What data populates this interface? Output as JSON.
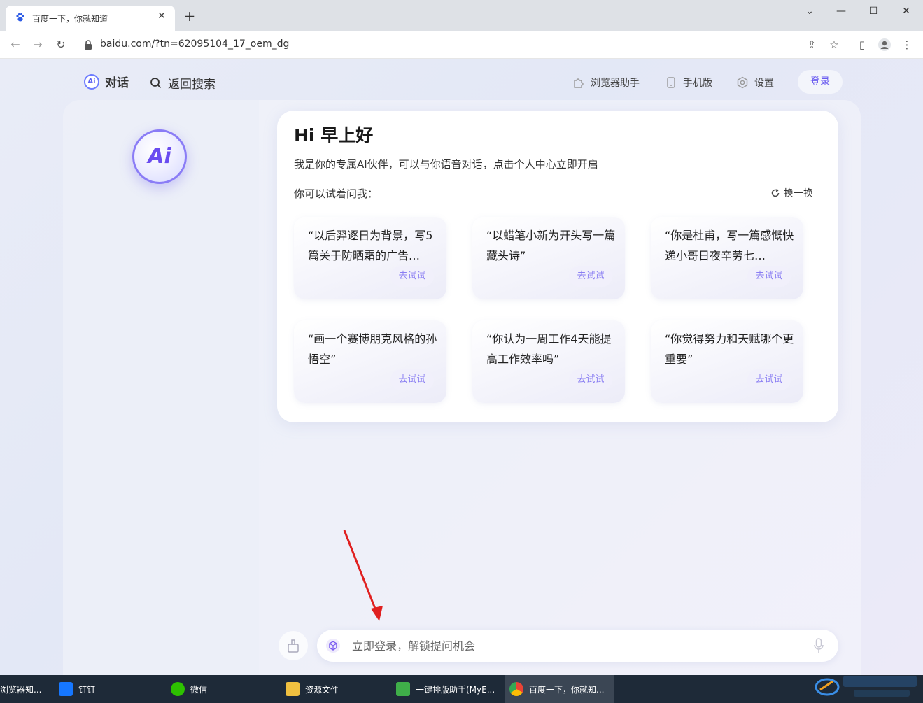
{
  "browser": {
    "tab_title": "百度一下，你就知道",
    "url": "baidu.com/?tn=62095104_17_oem_dg"
  },
  "topnav": {
    "dialog": "对话",
    "ai_badge": "Ai",
    "back_search": "返回搜索",
    "assistant": "浏览器助手",
    "mobile": "手机版",
    "settings": "设置",
    "login": "登录"
  },
  "logo": {
    "text": "Ai"
  },
  "welcome": {
    "greeting": "Hi 早上好",
    "intro": "我是你的专属AI伙伴，可以与你语音对话，点击个人中心立即开启",
    "try_label": "你可以试着问我：",
    "refresh": "换一换"
  },
  "suggestions": [
    {
      "text": "“以后羿逐日为背景，写5篇关于防晒霜的广告…",
      "button": "去试试"
    },
    {
      "text": "“以蜡笔小新为开头写一篇藏头诗”",
      "button": "去试试"
    },
    {
      "text": "“你是杜甫，写一篇感慨快递小哥日夜辛劳七…",
      "button": "去试试"
    },
    {
      "text": "“画一个赛博朋克风格的孙悟空”",
      "button": "去试试"
    },
    {
      "text": "“你认为一周工作4天能提高工作效率吗”",
      "button": "去试试"
    },
    {
      "text": "“你觉得努力和天赋哪个更重要”",
      "button": "去试试"
    }
  ],
  "input": {
    "placeholder": "立即登录，解锁提问机会"
  },
  "taskbar": {
    "items": [
      "浏览器知...",
      "钉钉",
      "微信",
      "资源文件",
      "一键排版助手(MyE...",
      "百度一下，你就知..."
    ]
  },
  "colors": {
    "accent": "#6a5cf0",
    "arrow": "#e02020"
  }
}
